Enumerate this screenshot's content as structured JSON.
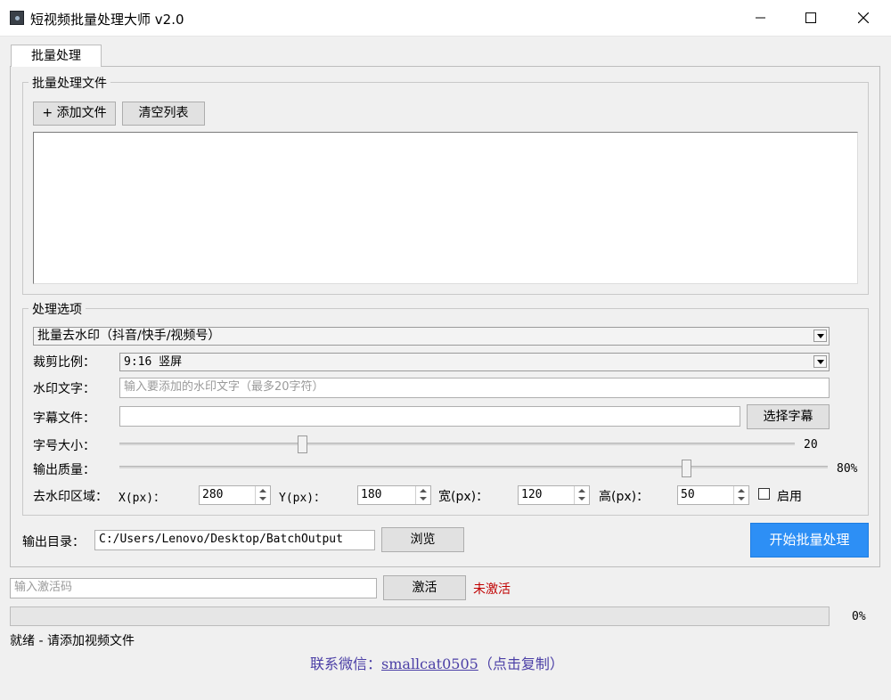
{
  "window": {
    "title": "短视频批量处理大师 v2.0",
    "minimize_glyph": "—",
    "maximize_glyph": "☐",
    "close_glyph": "✕"
  },
  "tabs": [
    {
      "label": "批量处理"
    }
  ],
  "files_group": {
    "title": "批量处理文件",
    "add_button": "+ 添加文件",
    "clear_button": "清空列表"
  },
  "options_group": {
    "title": "处理选项",
    "mode_select": {
      "value": "批量去水印（抖音/快手/视频号）"
    },
    "crop": {
      "label": "裁剪比例：",
      "value": "9:16 竖屏"
    },
    "watermark_text": {
      "label": "水印文字：",
      "placeholder": "输入要添加的水印文字（最多20字符）"
    },
    "subtitle": {
      "label": "字幕文件：",
      "value": "",
      "button": "选择字幕"
    },
    "font_size": {
      "label": "字号大小：",
      "value": "20",
      "level": 0.27
    },
    "quality": {
      "label": "输出质量：",
      "value": "80%",
      "level": 0.8
    },
    "region": {
      "label": "去水印区域：",
      "x_label": "X(px)：",
      "x": "280",
      "y_label": "Y(px)：",
      "y": "180",
      "w_label": "宽(px)：",
      "w": "120",
      "h_label": "高(px)：",
      "h": "50",
      "enable_label": "启用",
      "enabled": false
    }
  },
  "output": {
    "label": "输出目录：",
    "path": "C:/Users/Lenovo/Desktop/BatchOutput",
    "browse_button": "浏览",
    "start_button": "开始批量处理"
  },
  "activation": {
    "placeholder": "输入激活码",
    "button": "激活",
    "status": "未激活",
    "status_color": "#c00000"
  },
  "progress": {
    "value": "0%",
    "fraction": 0
  },
  "status_text": "就绪 - 请添加视频文件",
  "contact": {
    "prefix": "联系微信：",
    "wechat": "smallcat0505",
    "suffix": "（点击复制）"
  },
  "colors": {
    "accent": "#2d8ff5",
    "link": "#4b3fa6"
  }
}
